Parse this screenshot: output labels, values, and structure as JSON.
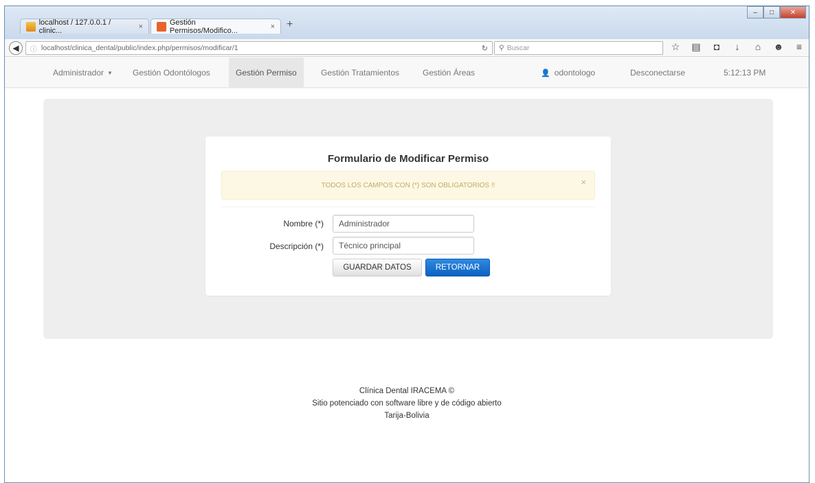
{
  "browser": {
    "tabs": [
      {
        "title": "localhost / 127.0.0.1 / clinic...",
        "close": "×"
      },
      {
        "title": "Gestión Permisos/Modifico...",
        "close": "×"
      }
    ],
    "new_tab": "+",
    "url": "localhost/clinica_dental/public/index.php/permisos/modificar/1",
    "search_placeholder": "Buscar",
    "window_buttons": {
      "minimize": "–",
      "maximize": "□",
      "close": "✕"
    }
  },
  "appnav": {
    "items": [
      {
        "label": "Administrador"
      },
      {
        "label": "Gestión Odontólogos"
      },
      {
        "label": "Gestión Permiso"
      },
      {
        "label": "Gestión Tratamientos"
      },
      {
        "label": "Gestión Áreas"
      }
    ],
    "user": "odontologo",
    "logout": "Desconectarse",
    "time": "5:12:13 PM"
  },
  "form": {
    "title": "Formulario de Modificar Permiso",
    "alert": "TODOS LOS CAMPOS CON (*) SON OBLIGATORIOS !!",
    "alert_close": "×",
    "nombre_label": "Nombre (*)",
    "nombre_value": "Administrador",
    "descripcion_label": "Descripción (*)",
    "descripcion_value": "Técnico principal",
    "save_label": "GUARDAR DATOS",
    "return_label": "RETORNAR"
  },
  "footer": {
    "line1": "Clínica Dental IRACEMA ©",
    "line2": "Sitio potenciado con software libre y de código abierto",
    "line3": "Tarija-Bolivia"
  },
  "colors": {
    "primary": "#0b61c1",
    "alert_bg": "#fcf8e3",
    "jumbotron": "#eeeeee"
  }
}
